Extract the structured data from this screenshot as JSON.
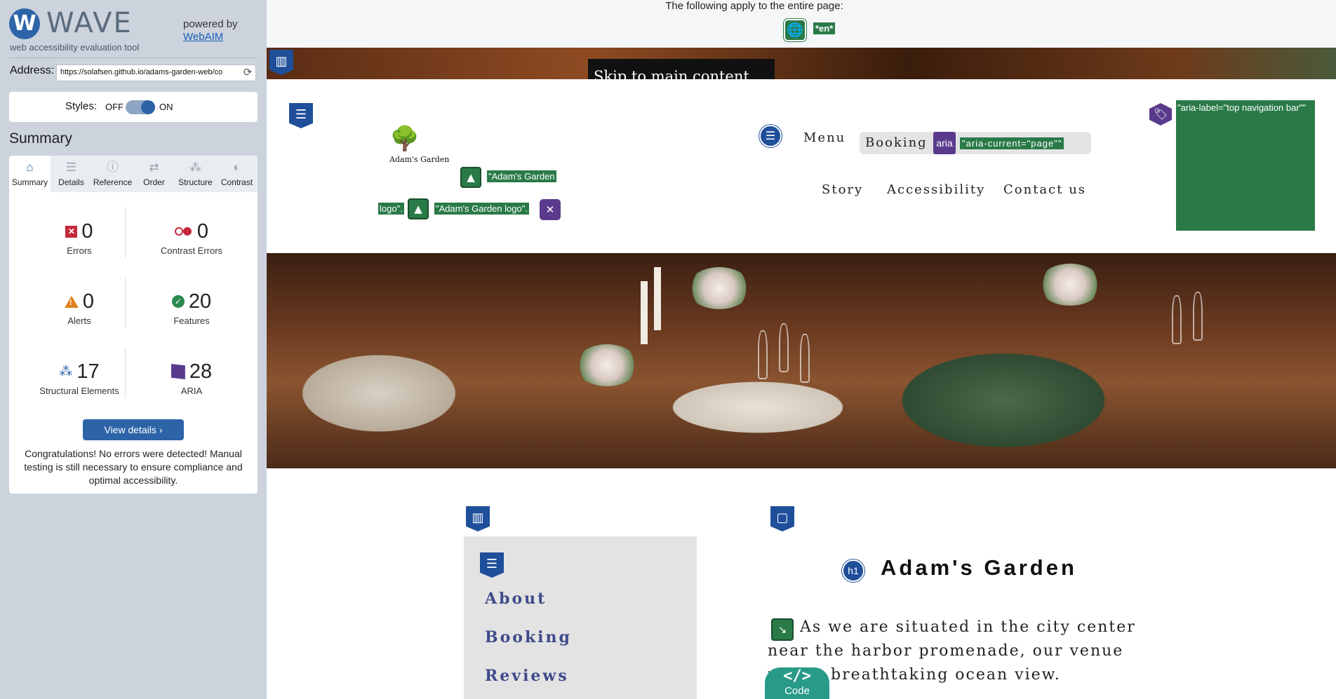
{
  "wave": {
    "logo_letter": "W",
    "brand": "WAVE",
    "tagline": "web accessibility evaluation tool",
    "powered_by": "powered by",
    "webaim": "WebAIM",
    "address_label": "Address:",
    "address_value": "https://solafsen.github.io/adams-garden-web/co",
    "styles_label": "Styles:",
    "styles_off": "OFF",
    "styles_on": "ON",
    "styles_state": "on",
    "summary_heading": "Summary",
    "tabs": [
      {
        "label": "Summary",
        "icon": "home-icon",
        "glyph": "⌂",
        "active": true
      },
      {
        "label": "Details",
        "icon": "list-icon",
        "glyph": "☰",
        "active": false
      },
      {
        "label": "Reference",
        "icon": "info-icon",
        "glyph": "ⓘ",
        "active": false
      },
      {
        "label": "Order",
        "icon": "order-icon",
        "glyph": "⇄",
        "active": false
      },
      {
        "label": "Structure",
        "icon": "structure-icon",
        "glyph": "⁂",
        "active": false
      },
      {
        "label": "Contrast",
        "icon": "contrast-icon",
        "glyph": "◐",
        "active": false
      }
    ],
    "stats": {
      "errors": {
        "value": "0",
        "label": "Errors"
      },
      "contrast_errors": {
        "value": "0",
        "label": "Contrast Errors"
      },
      "alerts": {
        "value": "0",
        "label": "Alerts"
      },
      "features": {
        "value": "20",
        "label": "Features"
      },
      "structural": {
        "value": "17",
        "label": "Structural Elements"
      },
      "aria": {
        "value": "28",
        "label": "ARIA"
      }
    },
    "view_details": "View details ›",
    "congrats": "Congratulations! No errors were detected! Manual testing is still necessary to ensure compliance and optimal accessibility."
  },
  "page": {
    "apply_text": "The following apply to the entire page:",
    "lang_tag": "*en*",
    "skip_link": "Skip to main content",
    "logo_caption": "Adam's Garden",
    "alt_tag_1a": "\"Adam's Garden",
    "alt_tag_1b": "logo\".",
    "alt_tag_2": "\"Adam's Garden logo\".",
    "nav": {
      "menu": "Menu",
      "booking": "Booking",
      "aria": "aria",
      "aria_current": "\"aria-current=\"page\"\"",
      "story": "Story",
      "accessibility": "Accessibility",
      "contact": "Contact us",
      "aria_label": "\"aria-label=\"top navigation bar\"\""
    },
    "side_menu": [
      "About",
      "Booking",
      "Reviews"
    ],
    "h1_badge": "h1",
    "heading": "Adam's Garden",
    "paragraph": "As we are situated in the city center near the harbor promenade, our venue with a breathtaking ocean view.",
    "code_label": "Code",
    "code_glyph": "</>"
  },
  "colors": {
    "wave_blue": "#2d64a8",
    "feature_green": "#2a7a48",
    "aria_purple": "#5a3a8c",
    "error_red": "#c4283a",
    "alert_orange": "#e0811b"
  }
}
